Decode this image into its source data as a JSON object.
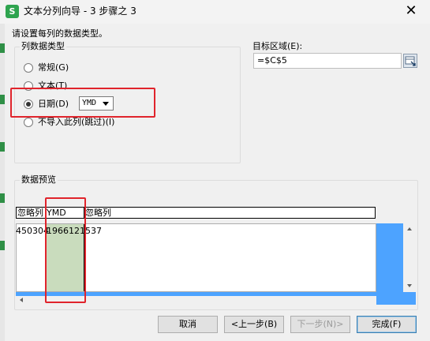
{
  "window": {
    "app_icon": "S",
    "title": "文本分列向导 - 3 步骤之 3",
    "close_symbol": "✕"
  },
  "instructions": "请设置每列的数据类型。",
  "column_type_group": {
    "legend": "列数据类型",
    "options": [
      {
        "label": "常规(G)",
        "checked": false
      },
      {
        "label": "文本(T)",
        "checked": false
      },
      {
        "label": "日期(D)",
        "checked": true
      },
      {
        "label": "不导入此列(跳过)(I)",
        "checked": false
      }
    ],
    "date_format": "YMD"
  },
  "destination": {
    "label": "目标区域(E):",
    "value": "=$C$5"
  },
  "preview": {
    "legend": "数据预览",
    "headers": [
      "忽略列",
      "YMD",
      "忽略列"
    ],
    "row": [
      "450304",
      "19661214",
      "537"
    ]
  },
  "buttons": {
    "cancel": "取消",
    "back": "<上一步(B)",
    "next": "下一步(N)>",
    "finish": "完成(F)"
  },
  "colors": {
    "highlight": "#e0242c",
    "selected_column": "#c9dcbd",
    "scroll_thumb": "#4da3ff",
    "app_icon": "#2ea44f"
  }
}
